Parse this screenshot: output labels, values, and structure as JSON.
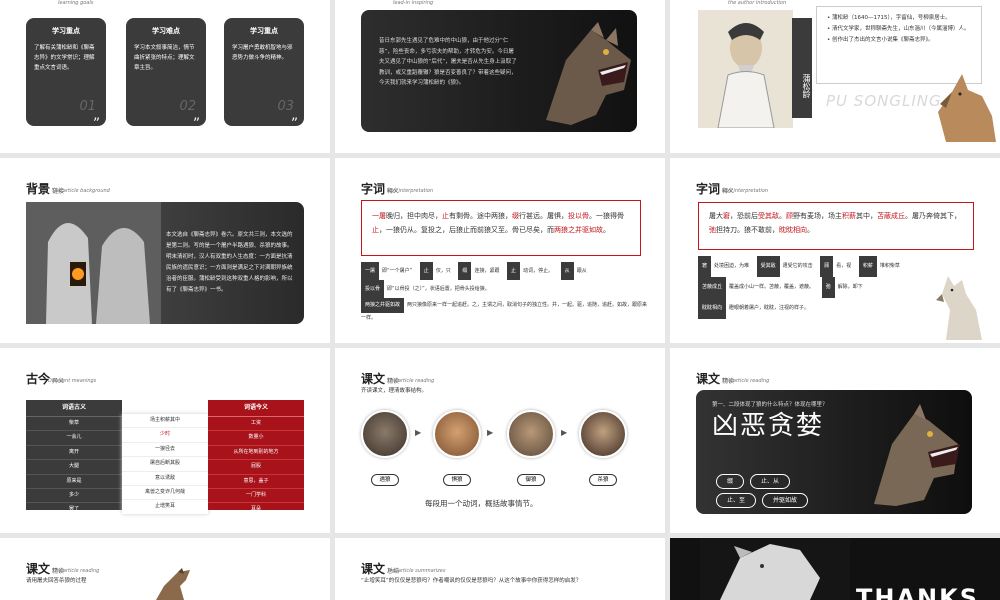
{
  "slides": {
    "s1": {
      "header": "learning goals",
      "cards": [
        {
          "title": "学习重点",
          "text": "了解有关蒲松龄和《聊斋志异》的文学常识；理解重点文言词语。",
          "num": "01"
        },
        {
          "title": "学习难点",
          "text": "学习本文叙事简洁，情节曲折紧张的特点；理解文章主旨。",
          "num": "02"
        },
        {
          "title": "学习重点",
          "text": "学习屠户勇敢机智地与邪恶势力做斗争的精神。",
          "num": "03"
        }
      ]
    },
    "s2": {
      "header": "lead-in inspiring",
      "text": "昔日东郭先生遇见了危难中的中山狼，由于他过分“仁慈”，险些丧命，多亏农夫的帮助，才转危为安。今日屠夫又遇见了中山狼的“后代”，屠夫是否从先生身上汲取了教训，或又重蹈覆辙？狼是否变善良了？带着这些疑问，今天我们就来学习蒲松龄的《狼》。"
    },
    "s3": {
      "header": "the author introduction",
      "name": "蒲松龄",
      "bullets": [
        "蒲松龄（1640—1715），字留仙，号柳泉居士。",
        "清代文学家，世称聊斋先生，山东淄川（今属淄博）人。",
        "创作出了杰出的文言小说集《聊斋志异》。"
      ],
      "watermark": "PU SONGLING"
    },
    "s4": {
      "title": "背景",
      "title_small": "链接",
      "subtitle": "The article background",
      "text": "本文选自《聊斋志异》卷六。原文共三则，本文选的是第二则。写的是一个屠户半路遇狼、杀狼的故事。明末清初时，汉人有双重的人生态度：一方面是抗清民族的遗民意识；一方面则是满足之下对满朝异族统治者的臣服。蒲松龄受到这种双重人格的影响，所以有了《聊斋志异》一书。"
    },
    "s5": {
      "title": "字词",
      "title_small": "释义",
      "subtitle": "text interpretation",
      "passage_parts": [
        {
          "t": "一屠",
          "red": true
        },
        {
          "t": "晚归，担中肉尽，",
          "red": false
        },
        {
          "t": "止",
          "red": true
        },
        {
          "t": "有剩骨。途中两狼，",
          "red": false
        },
        {
          "t": "缀",
          "red": true
        },
        {
          "t": "行甚远。屠惧，",
          "red": false
        },
        {
          "t": "投以骨",
          "red": true
        },
        {
          "t": "。一狼得骨",
          "red": false
        },
        {
          "t": "止",
          "red": true
        },
        {
          "t": "，一狼仍从。复投之，后狼止而前狼又至。骨已尽矣，而",
          "red": false
        },
        {
          "t": "两狼之并驱如故",
          "red": true
        },
        {
          "t": "。",
          "red": false
        }
      ],
      "defs_line1": [
        {
          "chip": "一屠",
          "text": "即“一个屠户”"
        },
        {
          "chip": "止",
          "text": "仅，只"
        },
        {
          "chip": "缀",
          "text": "连接，紧跟"
        },
        {
          "chip": "止",
          "text": "动词，停止。"
        },
        {
          "chip": "从",
          "text": "跟从"
        }
      ],
      "defs_line2": [
        {
          "chip": "投以骨",
          "text": "即“以骨投（之）”，状语后置，把骨头投给狼。"
        }
      ],
      "defs_line3": {
        "chip": "两狼之并驱如故",
        "text": "两只狼像原来一样一起追赶。之，主谓之间，取消句子的独立性。并，一起。驱，追随，追赶。如故，跟原来一样。"
      }
    },
    "s6": {
      "title": "字词",
      "title_small": "释义",
      "subtitle": "text interpretation",
      "passage_parts": [
        {
          "t": "屠大",
          "red": false
        },
        {
          "t": "窘",
          "red": true
        },
        {
          "t": "，恐前后",
          "red": false
        },
        {
          "t": "受其敌",
          "red": true
        },
        {
          "t": "。",
          "red": false
        },
        {
          "t": "顾",
          "red": true
        },
        {
          "t": "野有麦场，场主",
          "red": false
        },
        {
          "t": "积薪",
          "red": true
        },
        {
          "t": "其中，",
          "red": false
        },
        {
          "t": "苫蔽成丘",
          "red": true
        },
        {
          "t": "。屠乃奔倚其下，",
          "red": false
        },
        {
          "t": "弛",
          "red": true
        },
        {
          "t": "担持刀。狼不敢前，",
          "red": false
        },
        {
          "t": "眈眈相向",
          "red": true
        },
        {
          "t": "。",
          "red": false
        }
      ],
      "defs": [
        [
          {
            "chip": "窘",
            "text": "处境困迫，为难"
          },
          {
            "chip": "受其敌",
            "text": "遭受它的攻击"
          },
          {
            "chip": "顾",
            "text": "看，视"
          },
          {
            "chip": "积薪",
            "text": "堆积柴草"
          }
        ],
        [
          {
            "chip": "苫蔽成丘",
            "text": "覆盖成小山一样。苫蔽，覆盖，遮蔽。"
          },
          {
            "chip": "弛",
            "text": "解除，卸下"
          }
        ],
        [
          {
            "chip": "眈眈相向",
            "text": "瞪眼朝着屠户，眈眈，注视的样子。"
          }
        ]
      ]
    },
    "s7": {
      "title": "古今",
      "title_small": "异义",
      "subtitle": "Different meanings",
      "left_header": "词语古义",
      "left_items": [
        "柴草",
        "一会儿",
        "离开",
        "大腿",
        "原来是",
        "多少",
        "罢了"
      ],
      "middle_items": [
        {
          "t": "场主积薪其中",
          "red": false
        },
        {
          "t": "少时",
          "red": true
        },
        {
          "t": "一狼径去",
          "red": false
        },
        {
          "t": "屠自后断其股",
          "red": false
        },
        {
          "t": "意以诱敌",
          "red": false
        },
        {
          "t": "禽兽之变诈几何哉",
          "red": false
        },
        {
          "t": "止增笑耳",
          "red": false
        }
      ],
      "right_header": "词语今义",
      "right_items": [
        "工资",
        "数量小",
        "从所在地到别的地方",
        "屁股",
        "意思，盖子",
        "一门学科",
        "耳朵"
      ]
    },
    "s8": {
      "title": "课文",
      "title_small": "精读",
      "subtitle": "The article reading",
      "note": "齐读课文，理清故事结构。",
      "steps": [
        "遇狼",
        "惧狼",
        "御狼",
        "杀狼"
      ],
      "bottom": "每段用一个动词，概括故事情节。"
    },
    "s9": {
      "title": "课文",
      "title_small": "精读",
      "subtitle": "The article reading",
      "question": "第一、二段体现了狼的什么特点？体现在哪里？",
      "big": "凶恶贪婪",
      "chips": [
        "缀",
        "止、从",
        "止、至",
        "并驱如故"
      ]
    },
    "s10": {
      "title": "课文",
      "title_small": "精读",
      "subtitle": "The article reading",
      "note": "请用屠夫回答杀狼的过程"
    },
    "s11": {
      "title": "课文",
      "title_small": "总结",
      "subtitle": "The article summarizes",
      "note": "“止增笑耳”的仅仅是悲狼吗？作者嘲讽的仅仅是悲狼吗？从这个故事中你获得怎样的启发？"
    },
    "s12": {
      "text": "THANKS"
    }
  },
  "colors": {
    "accent": "#c4151c",
    "dark": "#3b3b3b"
  }
}
